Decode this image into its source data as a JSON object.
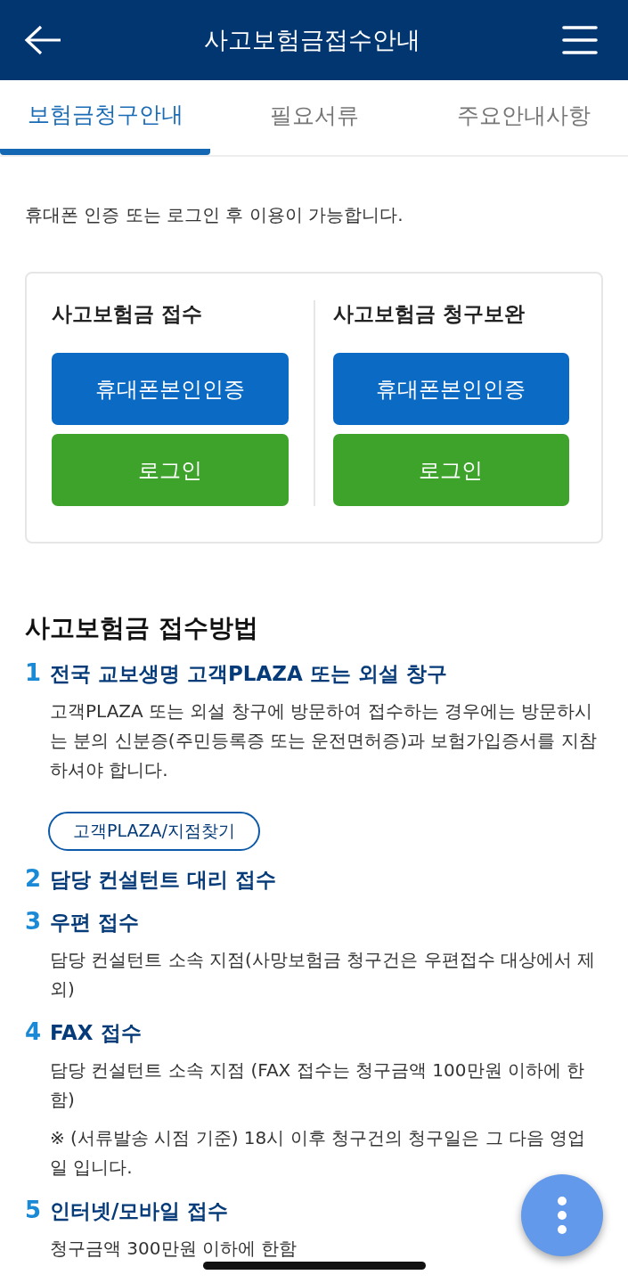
{
  "header": {
    "title": "사고보험금접수안내"
  },
  "tabs": [
    {
      "label": "보험금청구안내",
      "selected": true
    },
    {
      "label": "필요서류",
      "selected": false
    },
    {
      "label": "주요안내사항",
      "selected": false
    }
  ],
  "notice": "휴대폰 인증 또는 로그인 후 이용이 가능합니다.",
  "login_card": {
    "columns": [
      {
        "heading": "사고보험금 접수",
        "buttons": [
          {
            "label": "휴대폰본인인증",
            "kind": "verify"
          },
          {
            "label": "로그인",
            "kind": "login"
          }
        ]
      },
      {
        "heading": "사고보험금 청구보완",
        "buttons": [
          {
            "label": "휴대폰본인인증",
            "kind": "verify"
          },
          {
            "label": "로그인",
            "kind": "login"
          }
        ]
      }
    ]
  },
  "section": {
    "title": "사고보험금 접수방법",
    "steps": [
      {
        "number": "1",
        "title": "전국 교보생명 고객PLAZA 또는 외설 창구",
        "paragraphs": [
          "고객PLAZA 또는 외설 창구에 방문하여 접수하는 경우에는 방문하시는 분의 신분증(주민등록증 또는 운전면허증)과 보험가입증서를 지참하셔야 합니다."
        ],
        "button": "고객PLAZA/지점찾기"
      },
      {
        "number": "2",
        "title": "담당 컨설턴트 대리 접수"
      },
      {
        "number": "3",
        "title": "우편 접수",
        "paragraphs": [
          "담당 컨설턴트 소속 지점(사망보험금 청구건은 우편접수 대상에서 제외)"
        ]
      },
      {
        "number": "4",
        "title": "FAX 접수",
        "paragraphs": [
          "담당 컨설턴트 소속 지점 (FAX 접수는 청구금액 100만원 이하에 한함)",
          "※ (서류발송 시점 기준) 18시 이후 청구건의 청구일은 그 다음 영업일 입니다."
        ]
      },
      {
        "number": "5",
        "title": "인터넷/모바일 접수",
        "paragraphs": [
          "청구금액 300만원 이하에 한함"
        ]
      }
    ]
  }
}
